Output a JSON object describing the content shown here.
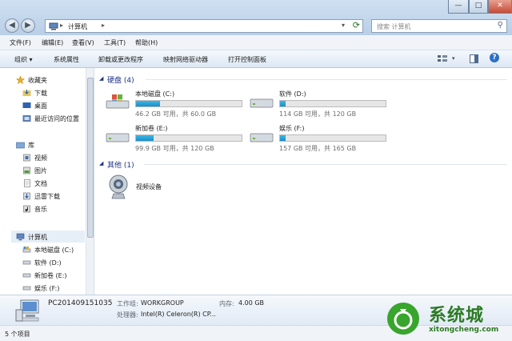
{
  "window": {
    "back_glyph": "◀",
    "forward_glyph": "▶",
    "minimize": "—",
    "maximize": "□",
    "close": "✕",
    "address_path": "计算机",
    "search_placeholder": "搜索 计算机"
  },
  "menu": [
    {
      "label": "文件(F)"
    },
    {
      "label": "编辑(E)"
    },
    {
      "label": "查看(V)"
    },
    {
      "label": "工具(T)"
    },
    {
      "label": "帮助(H)"
    }
  ],
  "toolbar": {
    "organize": "组织 ▾",
    "system_props": "系统属性",
    "uninstall": "卸载或更改程序",
    "map_drive": "映射网络驱动器",
    "control_panel": "打开控制面板"
  },
  "nav": {
    "favorites": "收藏夹",
    "downloads": "下载",
    "desktop": "桌面",
    "recent": "最近访问的位置",
    "libraries": "库",
    "videos": "视频",
    "pictures": "图片",
    "documents": "文档",
    "xunlei": "迅雷下载",
    "music": "音乐",
    "computer": "计算机",
    "drive_c": "本地磁盘 (C:)",
    "drive_d": "软件 (D:)",
    "drive_e": "新加卷 (E:)",
    "drive_f": "娱乐 (F:)"
  },
  "content": {
    "hard_disks_header": "硬盘 (4)",
    "other_header": "其他 (1)",
    "drives": [
      {
        "name": "本地磁盘 (C:)",
        "free": "46.2 GB 可用，共 60.0 GB",
        "used_fraction": 0.23
      },
      {
        "name": "软件 (D:)",
        "free": "114 GB 可用，共 120 GB",
        "used_fraction": 0.05
      },
      {
        "name": "新加卷 (E:)",
        "free": "99.9 GB 可用，共 120 GB",
        "used_fraction": 0.17
      },
      {
        "name": "娱乐 (F:)",
        "free": "157 GB 可用，共 165 GB",
        "used_fraction": 0.05
      }
    ],
    "video_device": "视频设备"
  },
  "details": {
    "pc_name": "PC201409151035",
    "workgroup_label": "工作组:",
    "workgroup": "WORKGROUP",
    "memory_label": "内存:",
    "memory": "4.00 GB",
    "processor_label": "处理器:",
    "processor": "Intel(R) Celeron(R) CP..."
  },
  "status": {
    "item_count": "5 个项目"
  },
  "watermark": {
    "brand": "系统城",
    "url": "xitongcheng.com"
  },
  "colors": {
    "bar_fill": "#1c8ec8",
    "group_header": "#1e3287",
    "watermark_green": "#38a52c"
  }
}
